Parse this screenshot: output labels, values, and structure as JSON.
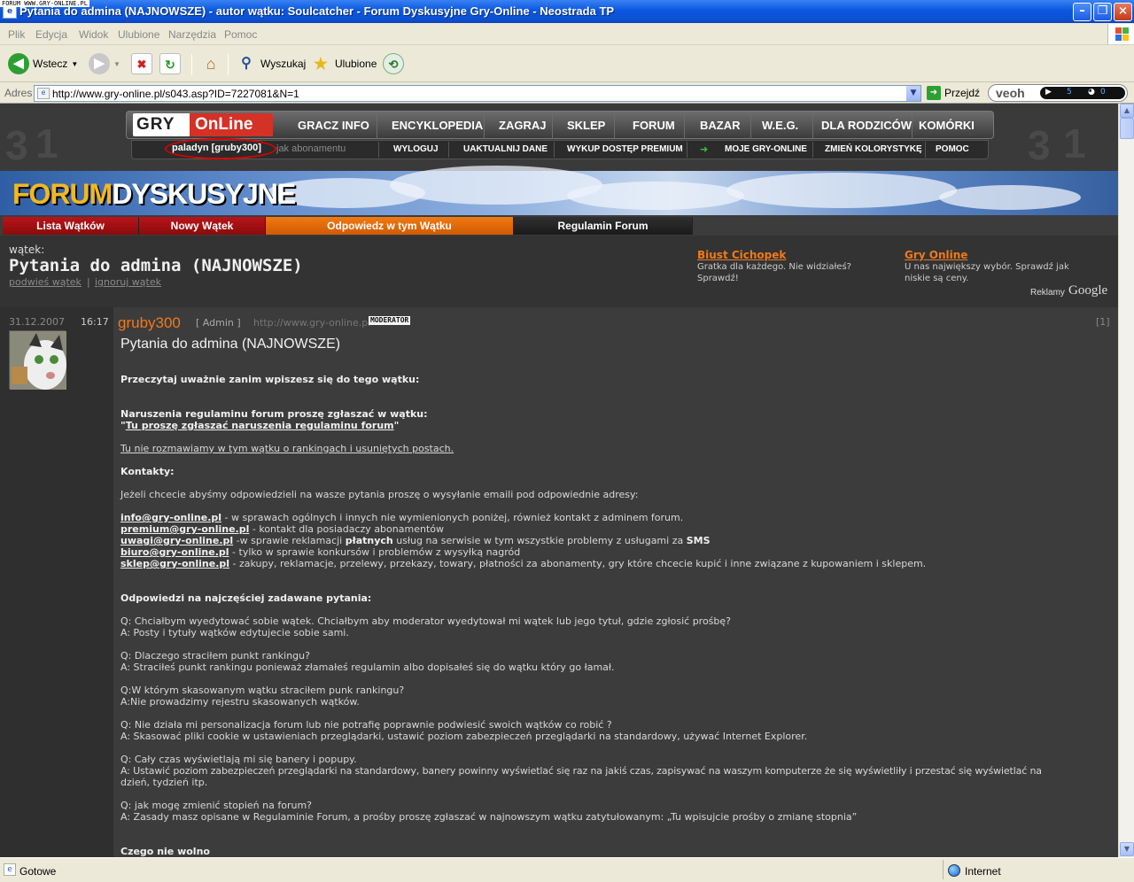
{
  "window": {
    "title": "Pytania do admina (NAJNOWSZE) - autor wątku: Soulcatcher - Forum Dyskusyjne Gry-Online - Neostrada TP",
    "corner_stamp": "FORUM WWW.GRY-ONLINE.PL"
  },
  "menu": [
    "Plik",
    "Edycja",
    "Widok",
    "Ulubione",
    "Narzędzia",
    "Pomoc"
  ],
  "toolbar": {
    "back": "Wstecz",
    "search": "Wyszukaj",
    "favorites": "Ulubione"
  },
  "address": {
    "label": "Adres",
    "url": "http://www.gry-online.pl/s043.asp?ID=7227081&N=1",
    "go": "Przejdź"
  },
  "veoh": {
    "brand": "veoh",
    "videos": "5",
    "feeds": "0"
  },
  "status": {
    "text": "Gotowe",
    "zone": "Internet"
  },
  "site": {
    "logo_left": "GRY",
    "logo_right": "OnLine",
    "nav": [
      "GRACZ INFO",
      "ENCYKLOPEDIA",
      "ZAGRAJ",
      "SKLEP",
      "FORUM",
      "BAZAR",
      "W.E.G.",
      "DLA RODZICÓW",
      "KOMÓRKI"
    ],
    "user": "paladyn [gruby300]",
    "subscription": "jak abonamentu",
    "subnav": [
      "WYLOGUJ",
      "UAKTUALNIJ DANE",
      "WYKUP DOSTĘP PREMIUM",
      "MOJE GRY-ONLINE",
      "ZMIEŃ KOLORYSTYKĘ",
      "POMOC"
    ],
    "forum_logo_a": "FORUM",
    "forum_logo_b": "DYSKUSYJNE"
  },
  "tabs": [
    "Lista Wątków",
    "Nowy Wątek",
    "Odpowiedz w tym Wątku",
    "Regulamin Forum"
  ],
  "thread": {
    "label": "wątek:",
    "title": "Pytania do admina (NAJNOWSZE)",
    "action_bump": "podwieś wątek",
    "action_sep": "|",
    "action_ignore": "ignoruj wątek"
  },
  "ads": [
    {
      "title": "Biust Cichopek",
      "text": "Gratka dla każdego. Nie widziałeś? Sprawdź!"
    },
    {
      "title": "Gry Online",
      "text": "U nas największy wybór. Sprawdź jak niskie są ceny."
    }
  ],
  "ads_by": "Reklamy",
  "ads_brand": "Google",
  "post": {
    "date": "31.12.2007",
    "time": "16:17",
    "author": "gruby300",
    "role": "[ Admin ]",
    "site": "http://www.gry-online.pl",
    "badge": "MODERATOR",
    "number": "[1]",
    "subject": "Pytania do admina (NAJNOWSZE)",
    "intro": "Przeczytaj uważnie zanim wpiszesz się do tego wątku:",
    "report_line": "Naruszenia regulaminu forum proszę zgłaszać w wątku:",
    "report_link": "Tu proszę zgłaszać naruszenia regulaminu forum",
    "no_talk": "Tu nie rozmawiamy w tym wątku o rankingach i usuniętych postach.",
    "contacts_head": "Kontakty:",
    "contacts_intro": "Jeżeli chcecie abyśmy odpowiedzieli na wasze pytania proszę o wysyłanie emaili pod odpowiednie adresy:",
    "contacts": [
      {
        "email": "info@gry-online.pl",
        "desc": " - w sprawach ogólnych i innych nie wymienionych poniżej, również kontakt z adminem forum."
      },
      {
        "email": "premium@gry-online.pl",
        "desc": " - kontakt dla posiadaczy abonamentów"
      },
      {
        "email": "uwagi@gry-online.pl",
        "desc": " -w sprawie reklamacji ",
        "bold1": "płatnych",
        "desc2": " usług na serwisie w tym wszystkie problemy z usługami za ",
        "bold2": "SMS"
      },
      {
        "email": "biuro@gry-online.pl",
        "desc": " - tylko w sprawie konkursów i problemów z wysyłką nagród"
      },
      {
        "email": "sklep@gry-online.pl",
        "desc": " - zakupy, reklamacje, przelewy, przekazy, towary, płatności za abonamenty, gry które chcecie kupić i inne związane z kupowaniem i sklepem."
      }
    ],
    "faq_head": "Odpowiedzi na najczęściej zadawane pytania:",
    "faq": [
      [
        "Q: Chciałbym wyedytować sobie wątek. Chciałbym aby moderator wyedytował mi wątek lub jego tytuł, gdzie zgłosić prośbę?",
        "A: Posty i tytuły wątków edytujecie sobie sami."
      ],
      [
        "Q: Dlaczego straciłem punkt rankingu?",
        "A: Straciłeś punkt rankingu ponieważ złamałeś regulamin albo dopisałeś się do wątku który go łamał."
      ],
      [
        "Q:W którym skasowanym wątku straciłem punk rankingu?",
        "A:Nie prowadzimy rejestru skasowanych wątków."
      ],
      [
        "Q: Nie działa mi personalizacja forum lub nie potrafię poprawnie podwiesić swoich wątków co robić ?",
        "A: Skasować pliki cookie w ustawieniach przeglądarki, ustawić poziom zabezpieczeń przeglądarki na standardowy, używać Internet Explorer."
      ],
      [
        "Q: Cały czas wyświetlają mi się banery i popupy.",
        "A: Ustawić poziom zabezpieczeń przeglądarki na standardowy, banery powinny wyświetlać się raz na jakiś czas, zapisywać na waszym komputerze że się wyświetliły i przestać się wyświetlać na",
        "dzień, tydzień itp."
      ],
      [
        "Q: jak mogę zmienić stopień na forum?",
        "A: Zasady masz opisane w Regulaminie Forum, a prośby proszę zgłaszać w najnowszym wątku zatytułowanym: „Tu wpisujcie prośby o zmianę stopnia”"
      ]
    ],
    "forbidden_head": "Czego nie wolno"
  },
  "colors": {
    "accent_orange": "#f07a1a",
    "tab_red": "#b01010",
    "tab_orange": "#e86c0a",
    "tab_dark": "#222222"
  }
}
